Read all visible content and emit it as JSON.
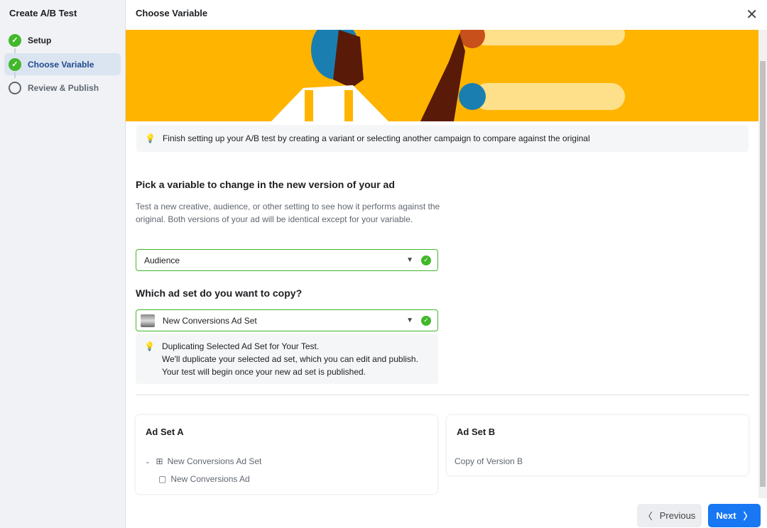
{
  "sidebar": {
    "title": "Create A/B Test",
    "steps": [
      {
        "label": "Setup",
        "status": "done"
      },
      {
        "label": "Choose Variable",
        "status": "active"
      },
      {
        "label": "Review & Publish",
        "status": "todo"
      }
    ]
  },
  "header": {
    "title": "Choose Variable"
  },
  "info": {
    "text": "Finish setting up your A/B test by creating a variant or selecting another campaign to compare against the original"
  },
  "variable": {
    "heading": "Pick a variable to change in the new version of your ad",
    "description": "Test a new creative, audience, or other setting to see how it performs against the original. Both versions of your ad will be identical except for your variable.",
    "selected": "Audience"
  },
  "adset": {
    "heading": "Which ad set do you want to copy?",
    "selected": "New Conversions Ad Set",
    "note_title": "Duplicating Selected Ad Set for Your Test.",
    "note_line1": "We'll duplicate your selected ad set, which you can edit and publish.",
    "note_line2": "Your test will begin once your new ad set is published."
  },
  "cards": {
    "a": {
      "title": "Ad Set A",
      "adset": "New Conversions Ad Set",
      "ad": "New Conversions Ad"
    },
    "b": {
      "title": "Ad Set B",
      "text": "Copy of Version B"
    }
  },
  "footer": {
    "previous": "Previous",
    "next": "Next"
  },
  "colors": {
    "accent": "#1877f2",
    "success": "#42b72a",
    "banner": "#ffb400"
  }
}
